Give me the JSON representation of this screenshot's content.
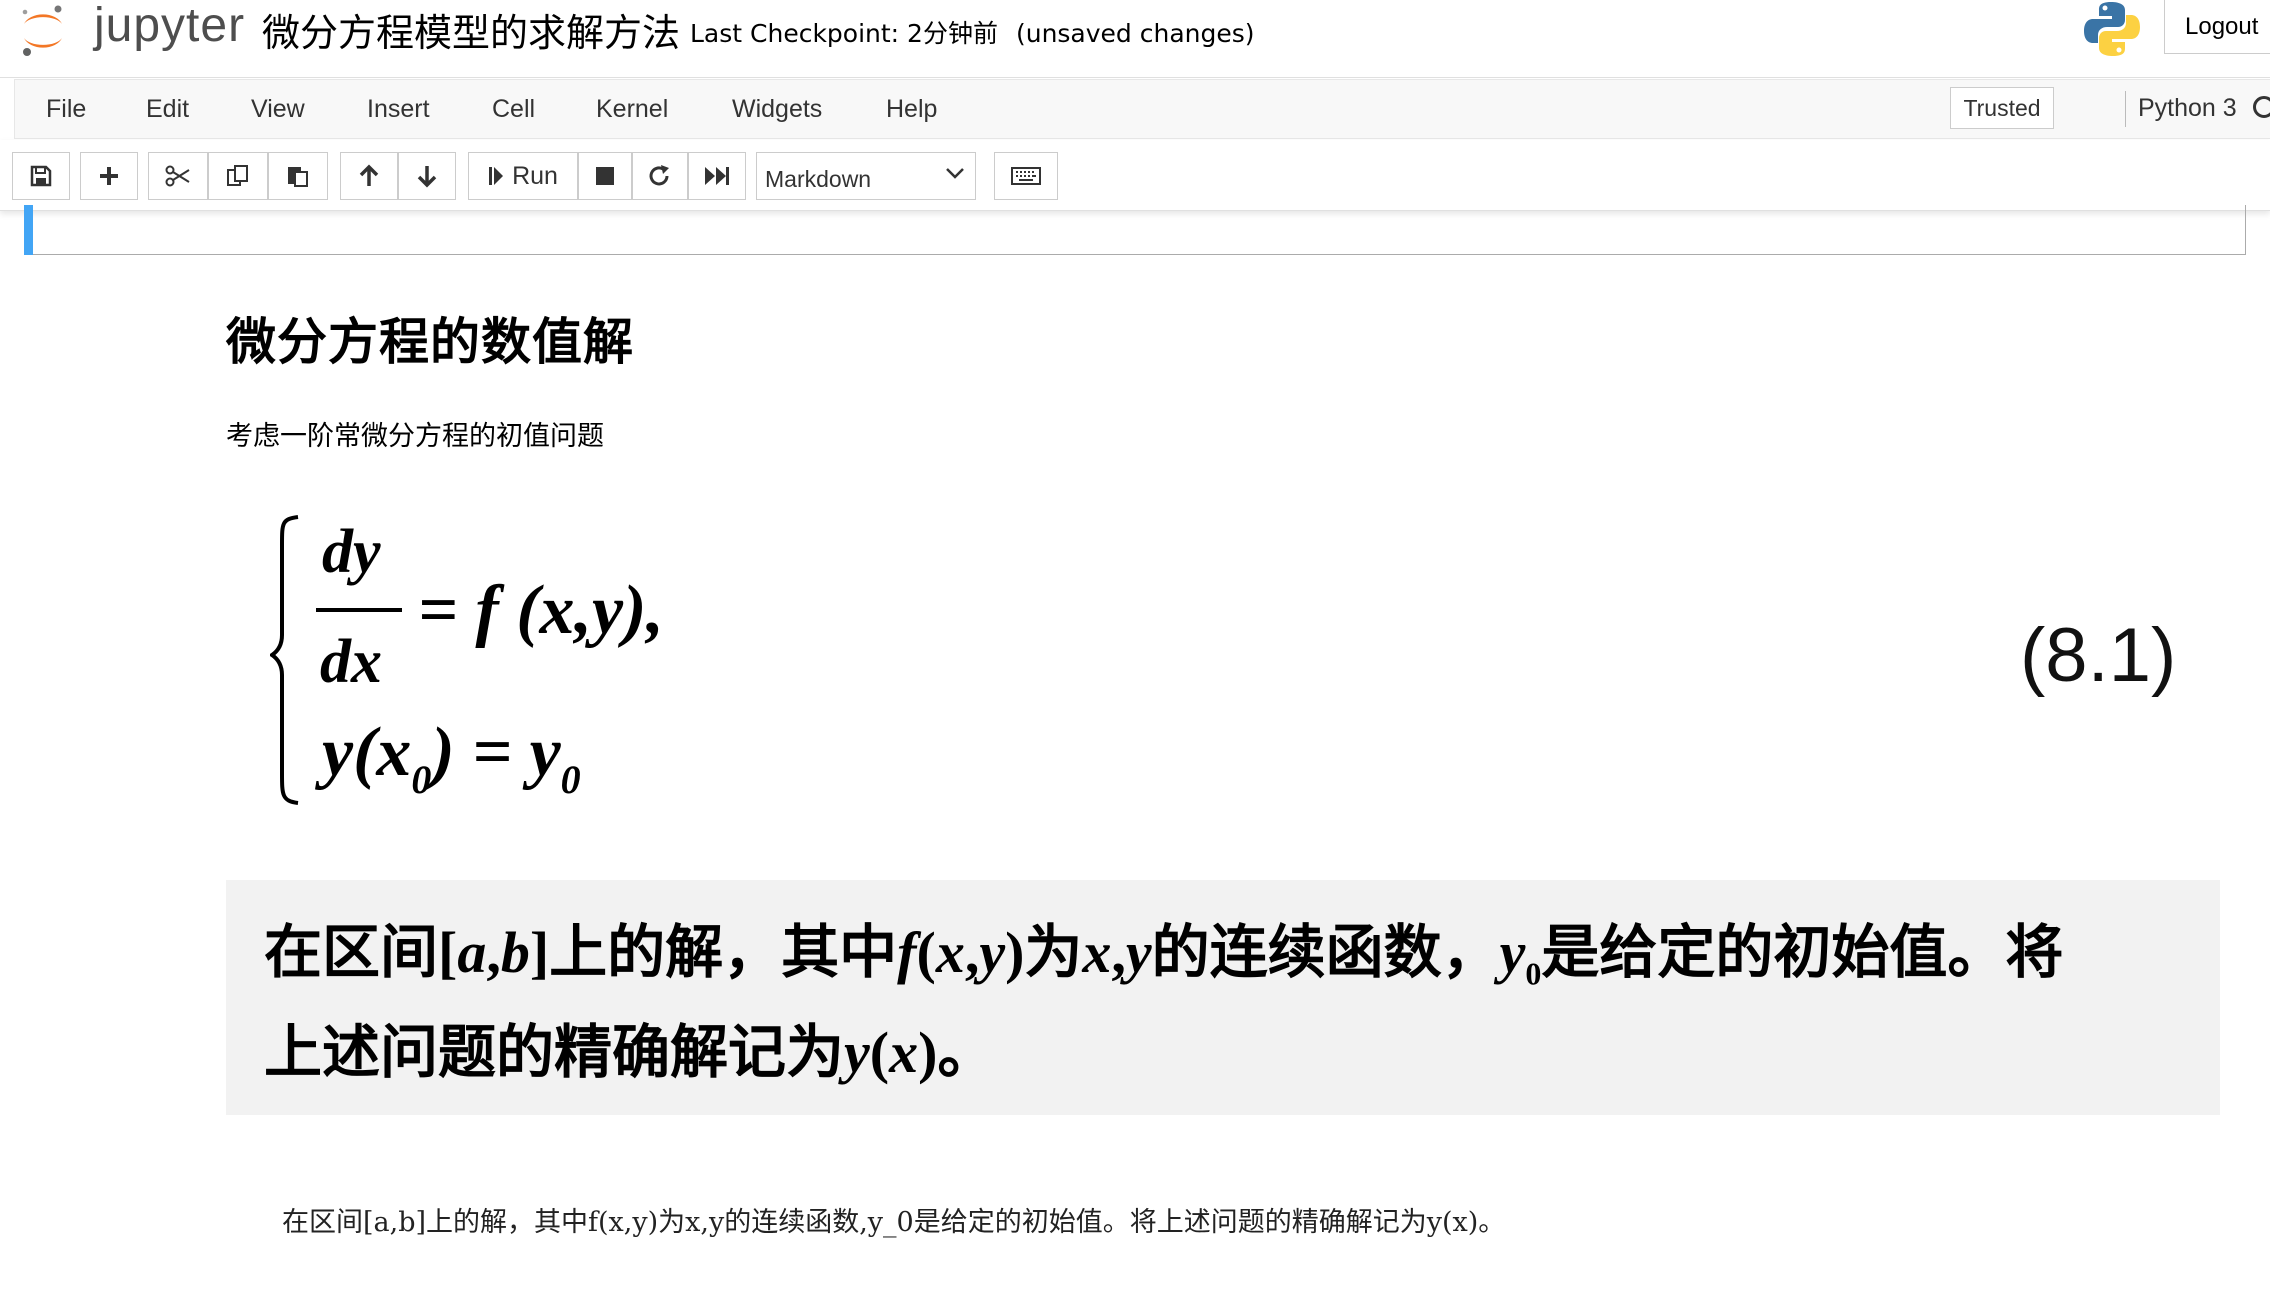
{
  "header": {
    "logo_text": "jupyter",
    "notebook_title": "微分方程模型的求解方法",
    "checkpoint_label": "Last Checkpoint: 2分钟前",
    "save_status": "(unsaved changes)",
    "logout_label": "Logout"
  },
  "menubar": {
    "items": [
      "File",
      "Edit",
      "View",
      "Insert",
      "Cell",
      "Kernel",
      "Widgets",
      "Help"
    ],
    "trusted_label": "Trusted",
    "kernel_name": "Python 3"
  },
  "toolbar": {
    "icons": [
      "save-icon",
      "plus-icon",
      "scissors-icon",
      "copy-icon",
      "paste-icon",
      "arrow-up-icon",
      "arrow-down-icon",
      "step-forward-icon",
      "stop-icon",
      "restart-icon",
      "fast-forward-icon",
      "keyboard-icon"
    ],
    "run_label": "Run",
    "cell_type": "Markdown"
  },
  "notebook": {
    "heading": "微分方程的数值解",
    "intro": "考虑一阶常微分方程的初值问题",
    "equation": {
      "frac_num": "dy",
      "frac_den": "dx",
      "rhs_1": "= f (x,y),",
      "lhs_2": "y(x",
      "sub_0": "0",
      "rhs_2a": ") = y",
      "number": "(8.1)"
    },
    "image_text": {
      "line1_a": "在区间[",
      "line1_b": "a",
      "line1_c": ",",
      "line1_d": "b",
      "line1_e": "]上的解，其中",
      "line1_f": "f",
      "line1_g": "(",
      "line1_h": "x",
      "line1_i": ",",
      "line1_j": "y",
      "line1_k": ")为",
      "line1_l": "x",
      "line1_m": ",",
      "line1_n": "y",
      "line1_o": "的连续函数，",
      "line1_p": "y",
      "line1_q": "0",
      "line1_r": "是给定的初始值。将",
      "line2_a": "上述问题的精确解记为",
      "line2_b": "y",
      "line2_c": "(",
      "line2_d": "x",
      "line2_e": ")。"
    },
    "plain_text": "在区间[a,b]上的解，其中f(x,y)为x,y的连续函数,y_0是给定的初始值。将上述问题的精确解记为y(x)。"
  }
}
